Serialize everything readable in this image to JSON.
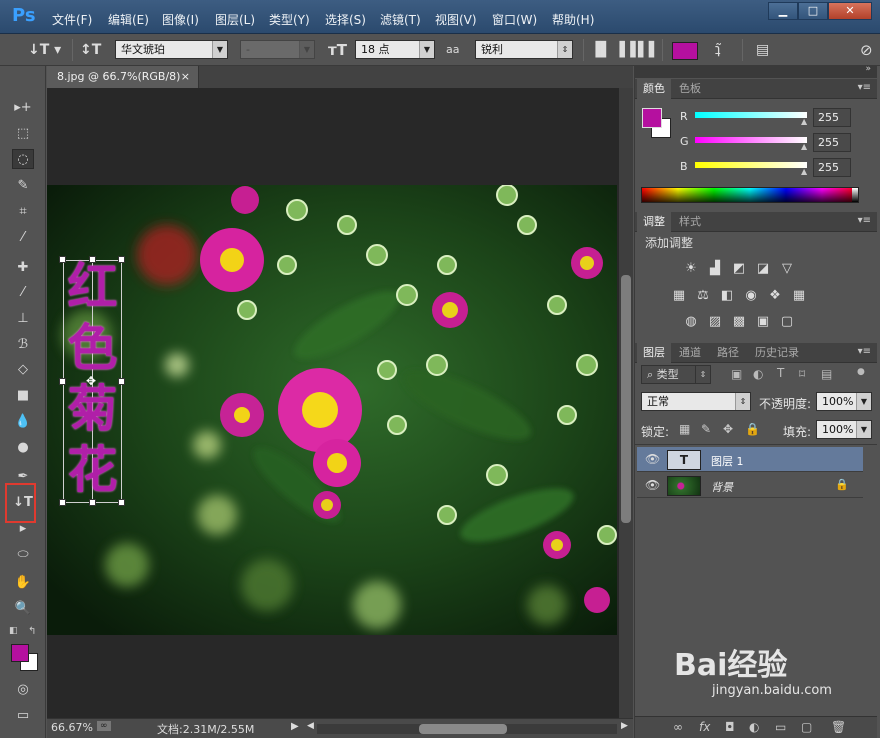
{
  "app": {
    "logo": "Ps"
  },
  "menu": [
    "文件(F)",
    "编辑(E)",
    "图像(I)",
    "图层(L)",
    "类型(Y)",
    "选择(S)",
    "滤镜(T)",
    "视图(V)",
    "窗口(W)",
    "帮助(H)"
  ],
  "window_controls": {
    "minimize": "▁",
    "maximize": "□",
    "close": "✕"
  },
  "options": {
    "font_family": "华文琥珀",
    "font_style": "-",
    "font_size": "18 点",
    "antialias_icon": "aa",
    "antialias": "锐利",
    "text_color": "#b5109f"
  },
  "document": {
    "tab_title": "8.jpg @ 66.7%(RGB/8)",
    "tab_close": "×",
    "vertical_text": [
      "红",
      "色",
      "菊",
      "花"
    ]
  },
  "status": {
    "zoom": "66.67%",
    "doc_info": "文档:2.31M/2.55M"
  },
  "color_panel": {
    "tabs": [
      "颜色",
      "色板"
    ],
    "fg_color": "#b5109f",
    "bg_color": "#ffffff",
    "channels": [
      {
        "label": "R",
        "value": "255"
      },
      {
        "label": "G",
        "value": "255"
      },
      {
        "label": "B",
        "value": "255"
      }
    ]
  },
  "adjust_panel": {
    "tabs": [
      "调整",
      "样式"
    ],
    "heading": "添加调整"
  },
  "layers_panel": {
    "tabs": [
      "图层",
      "通道",
      "路径",
      "历史记录"
    ],
    "filter_label": "类型",
    "blend_mode": "正常",
    "opacity_label": "不透明度:",
    "opacity_value": "100%",
    "lock_label": "锁定:",
    "fill_label": "填充:",
    "fill_value": "100%",
    "layers": [
      {
        "name": "图层 1",
        "type": "T"
      },
      {
        "name": "背景",
        "type": "image"
      }
    ]
  },
  "watermark": {
    "brand": "Bai经验",
    "url": "jingyan.baidu.com"
  }
}
